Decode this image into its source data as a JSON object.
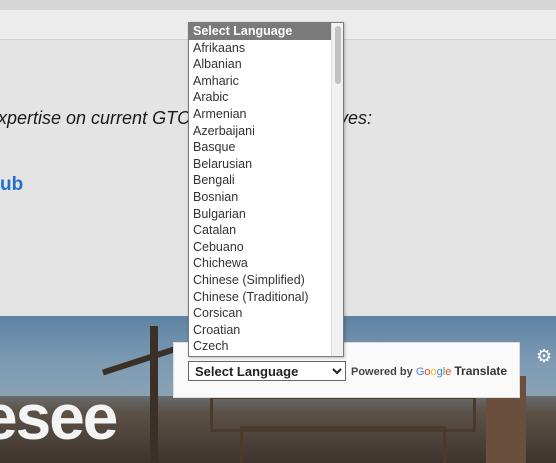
{
  "page": {
    "intro_text": "xpertise on current GTC",
    "intro_tail": "tives:",
    "link_text": "ub",
    "hero_title": "esee"
  },
  "translate": {
    "select_label": "Select Language",
    "powered_by": "Powered by",
    "google": "Google",
    "translate_word": "Translate",
    "languages": [
      "Select Language",
      "Afrikaans",
      "Albanian",
      "Amharic",
      "Arabic",
      "Armenian",
      "Azerbaijani",
      "Basque",
      "Belarusian",
      "Bengali",
      "Bosnian",
      "Bulgarian",
      "Catalan",
      "Cebuano",
      "Chichewa",
      "Chinese (Simplified)",
      "Chinese (Traditional)",
      "Corsican",
      "Croatian",
      "Czech"
    ],
    "selected_index": 0
  },
  "colors": {
    "link": "#1f6fd1",
    "selected_bg": "#7a7a7a",
    "google_blue": "#4285f4",
    "google_red": "#ea4335",
    "google_yellow": "#fbbc05",
    "google_green": "#34a853"
  },
  "icons": {
    "settings": "gear-icon"
  }
}
